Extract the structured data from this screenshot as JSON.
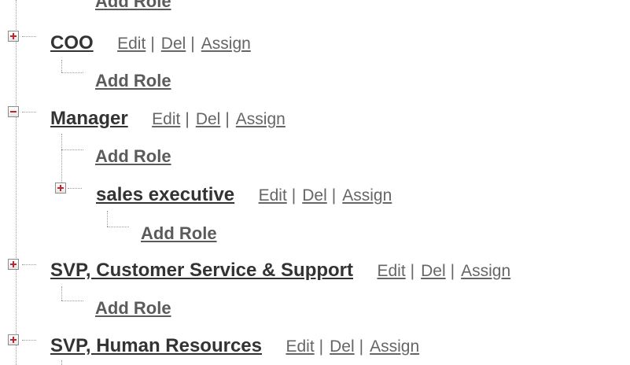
{
  "tree": {
    "top_partial": {
      "label": "Add Role"
    },
    "coo": {
      "label": "COO",
      "edit": "Edit",
      "sep1": "|",
      "del": "Del",
      "sep2": "|",
      "assign": "Assign",
      "add_role": "Add Role",
      "state": "collapsed"
    },
    "manager": {
      "label": "Manager",
      "edit": "Edit",
      "sep1": "|",
      "del": "Del",
      "sep2": "|",
      "assign": "Assign",
      "add_role": "Add Role",
      "state": "expanded",
      "sales_executive": {
        "label": "sales executive",
        "edit": "Edit",
        "sep1": "|",
        "del": "Del",
        "sep2": "|",
        "assign": "Assign",
        "add_role": "Add Role",
        "state": "collapsed"
      }
    },
    "svp_customer": {
      "label": "SVP, Customer Service & Support",
      "edit": "Edit",
      "sep1": "|",
      "del": "Del",
      "sep2": "|",
      "assign": "Assign",
      "add_role": "Add Role",
      "state": "collapsed"
    },
    "svp_hr": {
      "label": "SVP, Human Resources",
      "edit": "Edit",
      "sep1": "|",
      "del": "Del",
      "sep2": "|",
      "assign": "Assign",
      "state": "collapsed"
    }
  },
  "colors": {
    "toggle_sign": "#c0262d",
    "node_text": "#333333",
    "link_text": "#666666",
    "connector": "#9a9a9a"
  },
  "icons": {
    "collapsed": "plus-box-icon",
    "expanded": "minus-box-icon"
  }
}
